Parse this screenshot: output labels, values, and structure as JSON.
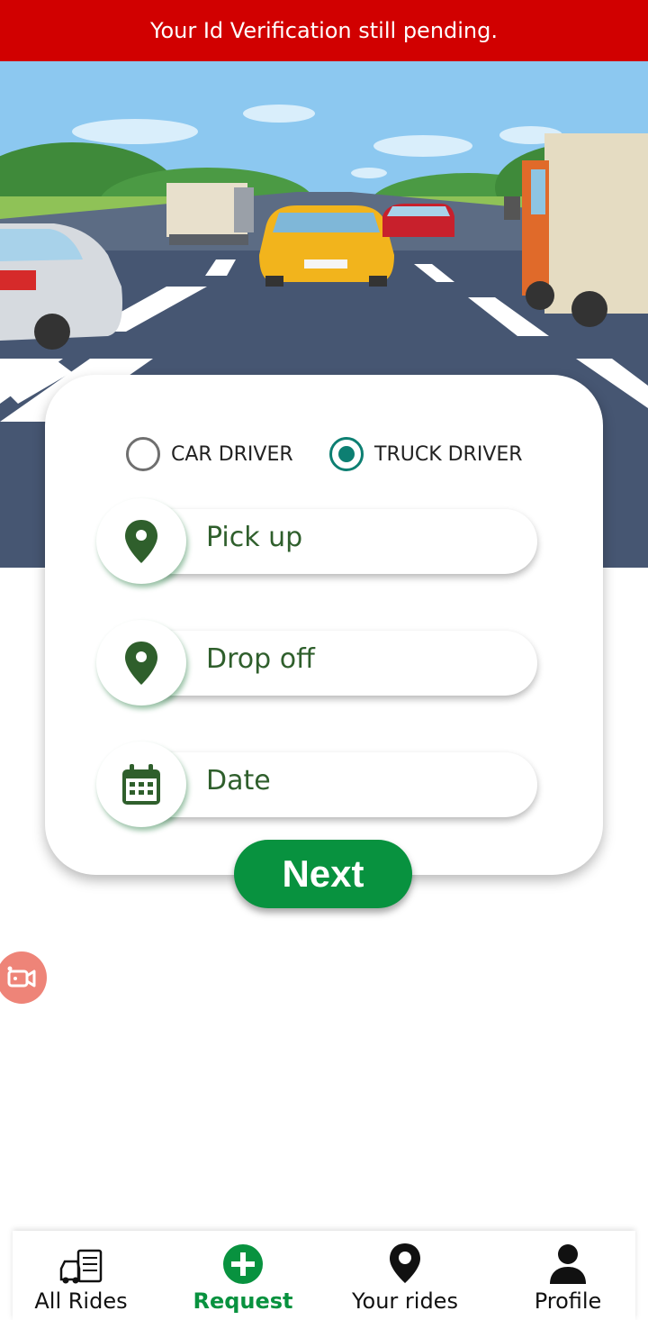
{
  "banner": {
    "text": "Your Id Verification still pending."
  },
  "driver_type": {
    "options": [
      {
        "label": "CAR DRIVER",
        "selected": false
      },
      {
        "label": "TRUCK DRIVER",
        "selected": true
      }
    ]
  },
  "fields": {
    "pickup": {
      "label": "Pick up",
      "icon": "map-pin-icon"
    },
    "dropoff": {
      "label": "Drop off",
      "icon": "map-pin-icon"
    },
    "date": {
      "label": "Date",
      "icon": "calendar-icon"
    }
  },
  "next_button": {
    "label": "Next"
  },
  "bottom_nav": {
    "items": [
      {
        "label": "All Rides",
        "icon": "rides-list-icon",
        "active": false
      },
      {
        "label": "Request",
        "icon": "plus-circle-icon",
        "active": true
      },
      {
        "label": "Your rides",
        "icon": "map-pin-icon",
        "active": false
      },
      {
        "label": "Profile",
        "icon": "user-icon",
        "active": false
      }
    ]
  },
  "colors": {
    "banner": "#d10000",
    "primary_green": "#08923f",
    "icon_green": "#2f5f2c",
    "radio_teal": "#0d7f72"
  }
}
